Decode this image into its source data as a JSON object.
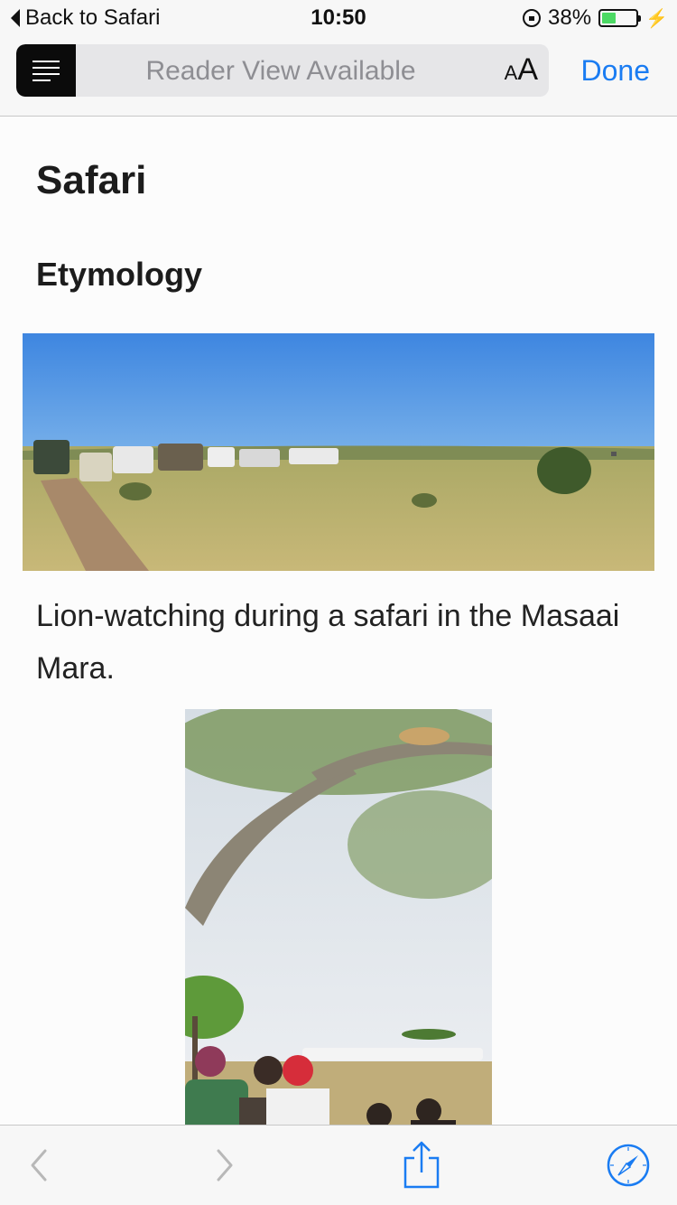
{
  "status_bar": {
    "back_label": "Back to Safari",
    "time": "10:50",
    "battery_percent": "38%",
    "battery_level": 0.38
  },
  "nav": {
    "address_text": "Reader View Available",
    "text_size_small": "A",
    "text_size_large": "A",
    "done_label": "Done"
  },
  "article": {
    "title": "Safari",
    "section_heading": "Etymology",
    "caption": "Lion-watching during a safari in the Masaai Mara."
  },
  "icons": {
    "reader": "reader-list-icon",
    "back": "back-arrow-icon",
    "forward": "forward-arrow-icon",
    "share": "share-icon",
    "safari": "compass-icon"
  },
  "colors": {
    "accent": "#1a7cf2",
    "battery": "#4cd964",
    "sky": "#4a8fdc",
    "grass": "#b9ad6a"
  }
}
